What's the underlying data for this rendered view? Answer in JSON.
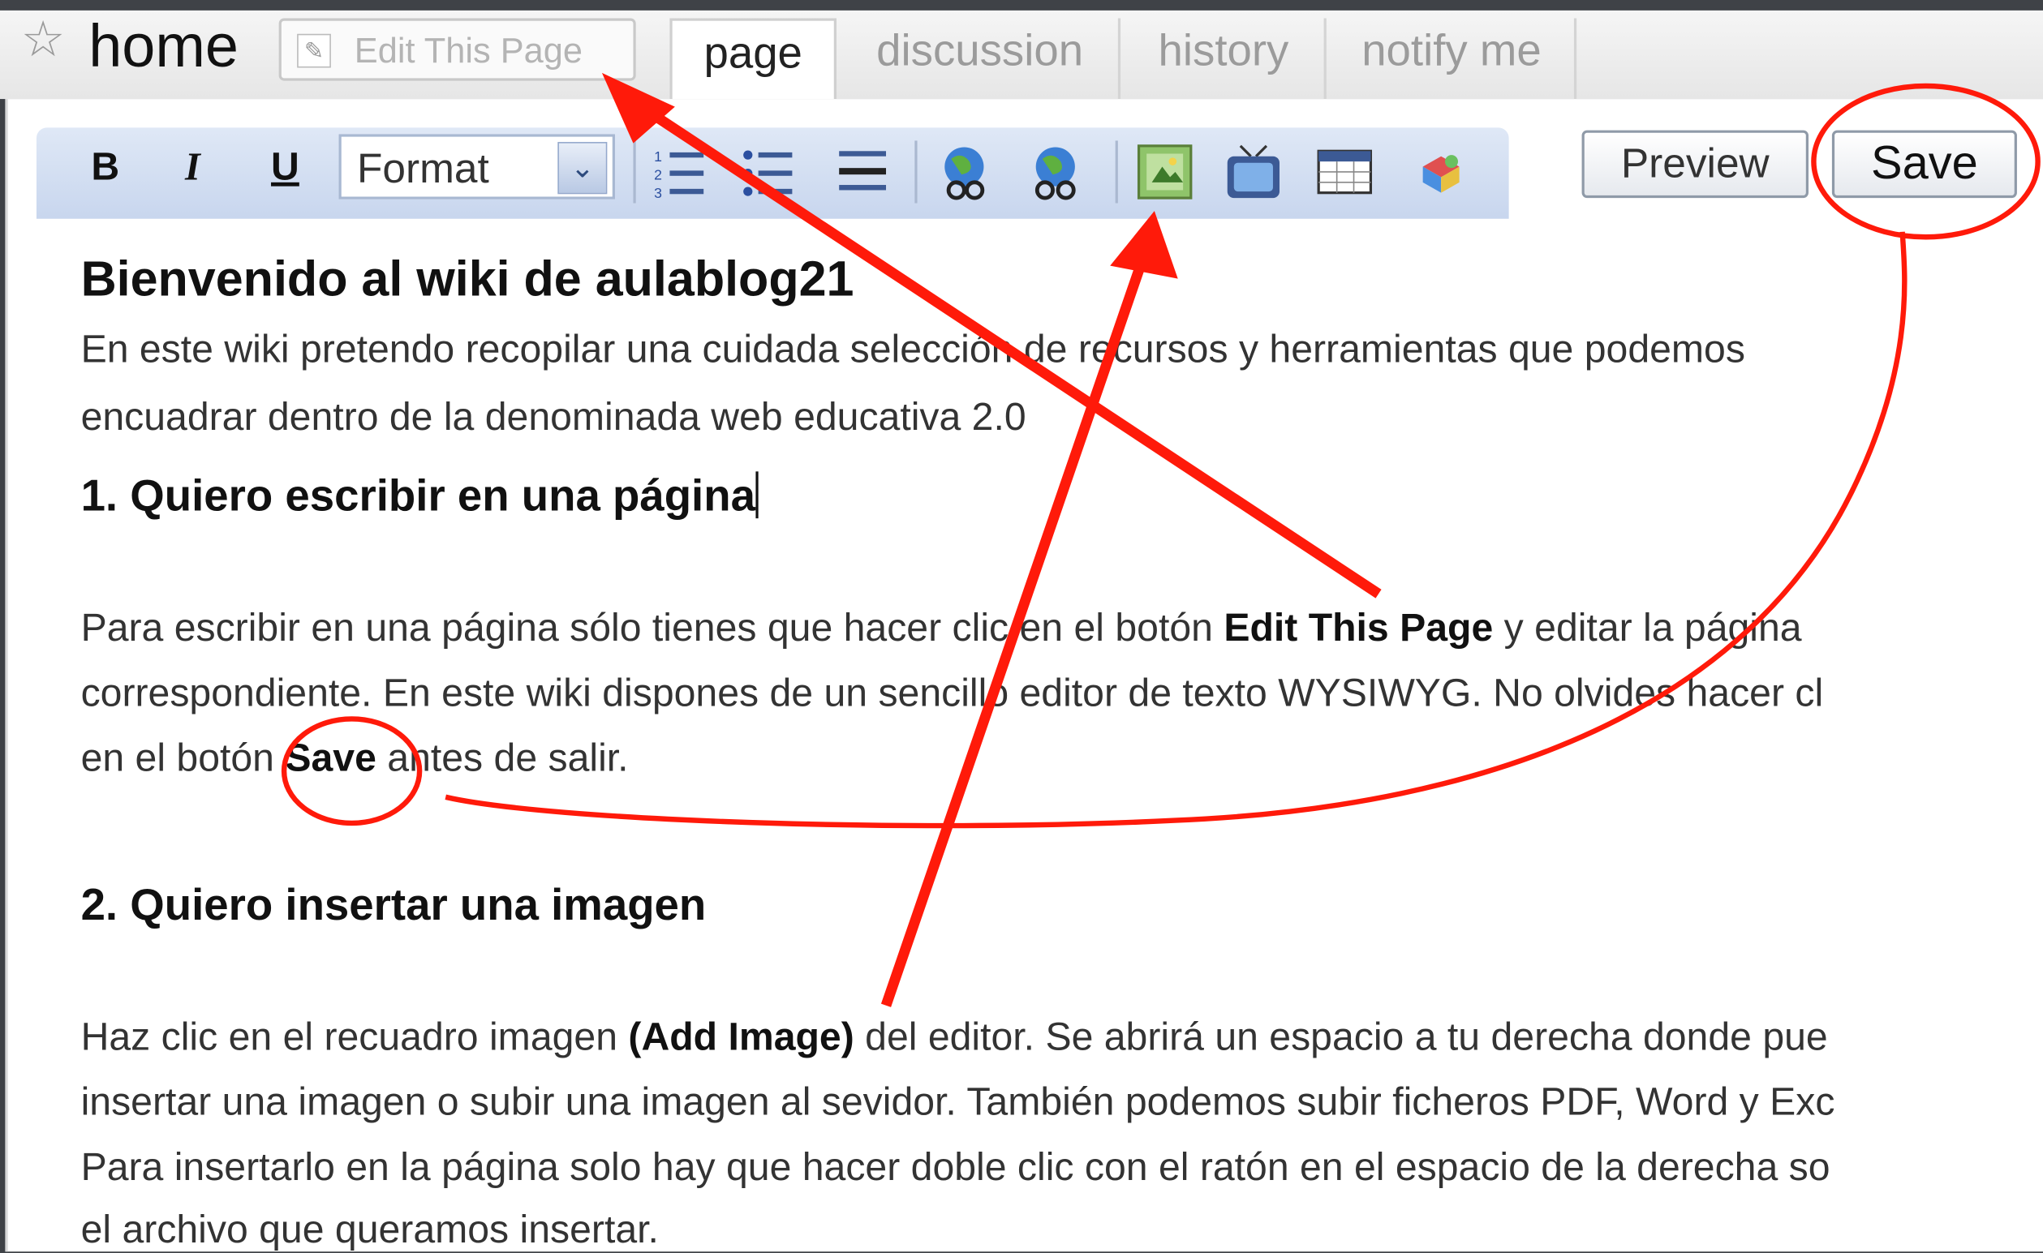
{
  "header": {
    "page_name": "home",
    "edit_button_label": "Edit This Page",
    "tabs": [
      {
        "label": "page",
        "active": true
      },
      {
        "label": "discussion",
        "active": false
      },
      {
        "label": "history",
        "active": false
      },
      {
        "label": "notify me",
        "active": false
      }
    ]
  },
  "toolbar": {
    "bold": "B",
    "italic": "I",
    "underline": "U",
    "format_label": "Format",
    "icons": [
      "numbered-list-icon",
      "bullet-list-icon",
      "horizontal-rule-icon",
      "link-icon",
      "external-link-icon",
      "add-image-icon",
      "add-video-icon",
      "table-icon",
      "widget-icon"
    ],
    "preview_label": "Preview",
    "save_label": "Save"
  },
  "content": {
    "title": "Bienvenido al wiki de aulablog21",
    "intro_line1": "En este wiki pretendo recopilar una cuidada selección de recursos y herramientas que podemos",
    "intro_line2": "encuadrar dentro de la denominada web educativa 2.0",
    "section1_title": "1. Quiero escribir en una página",
    "s1_l1_a": "Para escribir en una página sólo tienes que hacer clic en el botón ",
    "s1_l1_b": "Edit This Page",
    "s1_l1_c": " y editar la página",
    "s1_l2": "correspondiente. En este wiki dispones de un sencillo editor de texto WYSIWYG. No olvides hacer cl",
    "s1_l3_a": "en el botón ",
    "s1_l3_b": "Save",
    "s1_l3_c": " antes de salir.",
    "section2_title": "2. Quiero insertar una imagen",
    "s2_l1_a": "Haz clic en el recuadro imagen ",
    "s2_l1_b": "(Add Image)",
    "s2_l1_c": " del editor. Se abrirá un espacio a tu derecha donde pue",
    "s2_l2": "insertar una imagen o subir una imagen al sevidor. También podemos subir ficheros PDF, Word y Exc",
    "s2_l3": "Para insertarlo en la página solo hay que hacer doble clic con el ratón en el espacio de la derecha so",
    "s2_l4": "el archivo que queramos insertar."
  },
  "colors": {
    "annotation_red": "#ff1a0a",
    "toolbar_blue": "#c8d6ee"
  }
}
